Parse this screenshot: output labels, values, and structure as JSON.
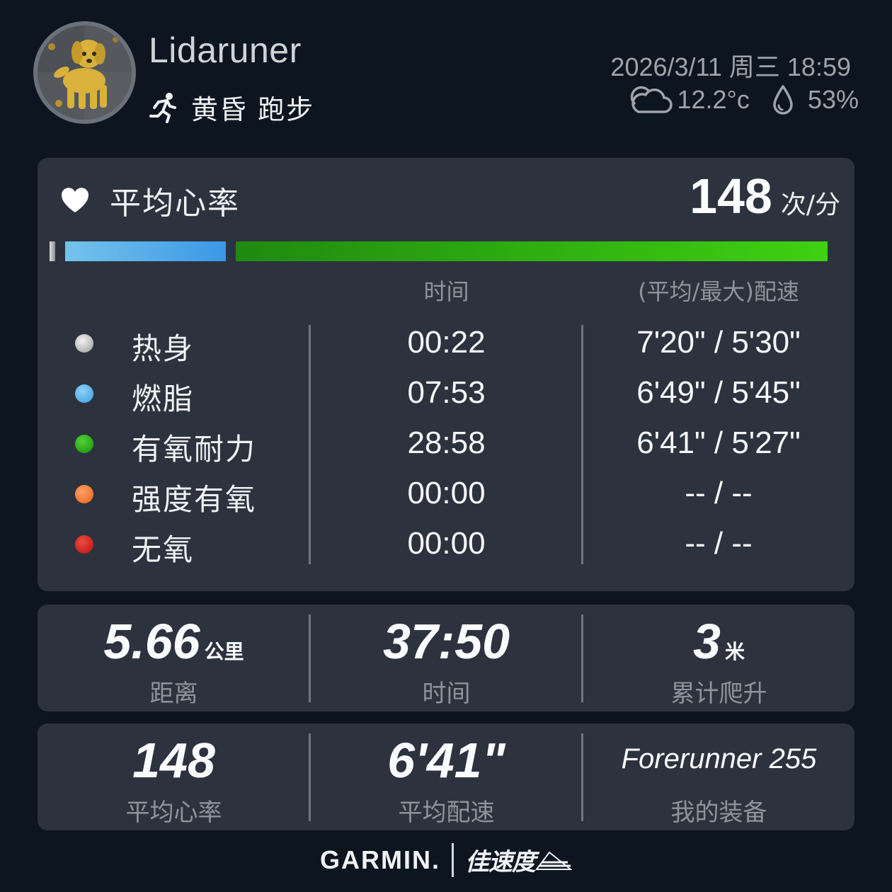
{
  "header": {
    "username": "Lidaruner",
    "activity_label": "黄昏 跑步",
    "datetime": "2026/3/11 周三 18:59",
    "temperature": "12.2°c",
    "humidity": "53%"
  },
  "heart_rate": {
    "title": "平均心率",
    "value": "148",
    "unit": "次/分",
    "col_time": "时间",
    "col_pace": "(平均/最大)配速",
    "zones": [
      {
        "name": "热身",
        "time": "00:22",
        "pace": "7'20\" / 5'30\"",
        "color": "#c8c8c8"
      },
      {
        "name": "燃脂",
        "time": "07:53",
        "pace": "6'49\" / 5'45\"",
        "color": "#4fb0ec"
      },
      {
        "name": "有氧耐力",
        "time": "28:58",
        "pace": "6'41\" / 5'27\"",
        "color": "#2aa71a"
      },
      {
        "name": "强度有氧",
        "time": "00:00",
        "pace": "-- / --",
        "color": "#ff7a32"
      },
      {
        "name": "无氧",
        "time": "00:00",
        "pace": "-- / --",
        "color": "#d4221c"
      }
    ],
    "zone_bar_fraction": [
      0.006,
      0.208,
      0.766,
      0,
      0
    ]
  },
  "stats_row1": [
    {
      "value": "5.66",
      "unit": "公里",
      "label": "距离"
    },
    {
      "value": "37:50",
      "unit": "",
      "label": "时间"
    },
    {
      "value": "3",
      "unit": "米",
      "label": "累计爬升"
    }
  ],
  "stats_row2": [
    {
      "value": "148",
      "label": "平均心率"
    },
    {
      "value": "6'41\"",
      "label": "平均配速"
    },
    {
      "value": "Forerunner 255",
      "label": "我的装备"
    }
  ],
  "footer": {
    "brand": "GARMIN.",
    "partner": "佳速度"
  },
  "colors": {
    "background": "#0d1520",
    "card": "#2c333e"
  }
}
